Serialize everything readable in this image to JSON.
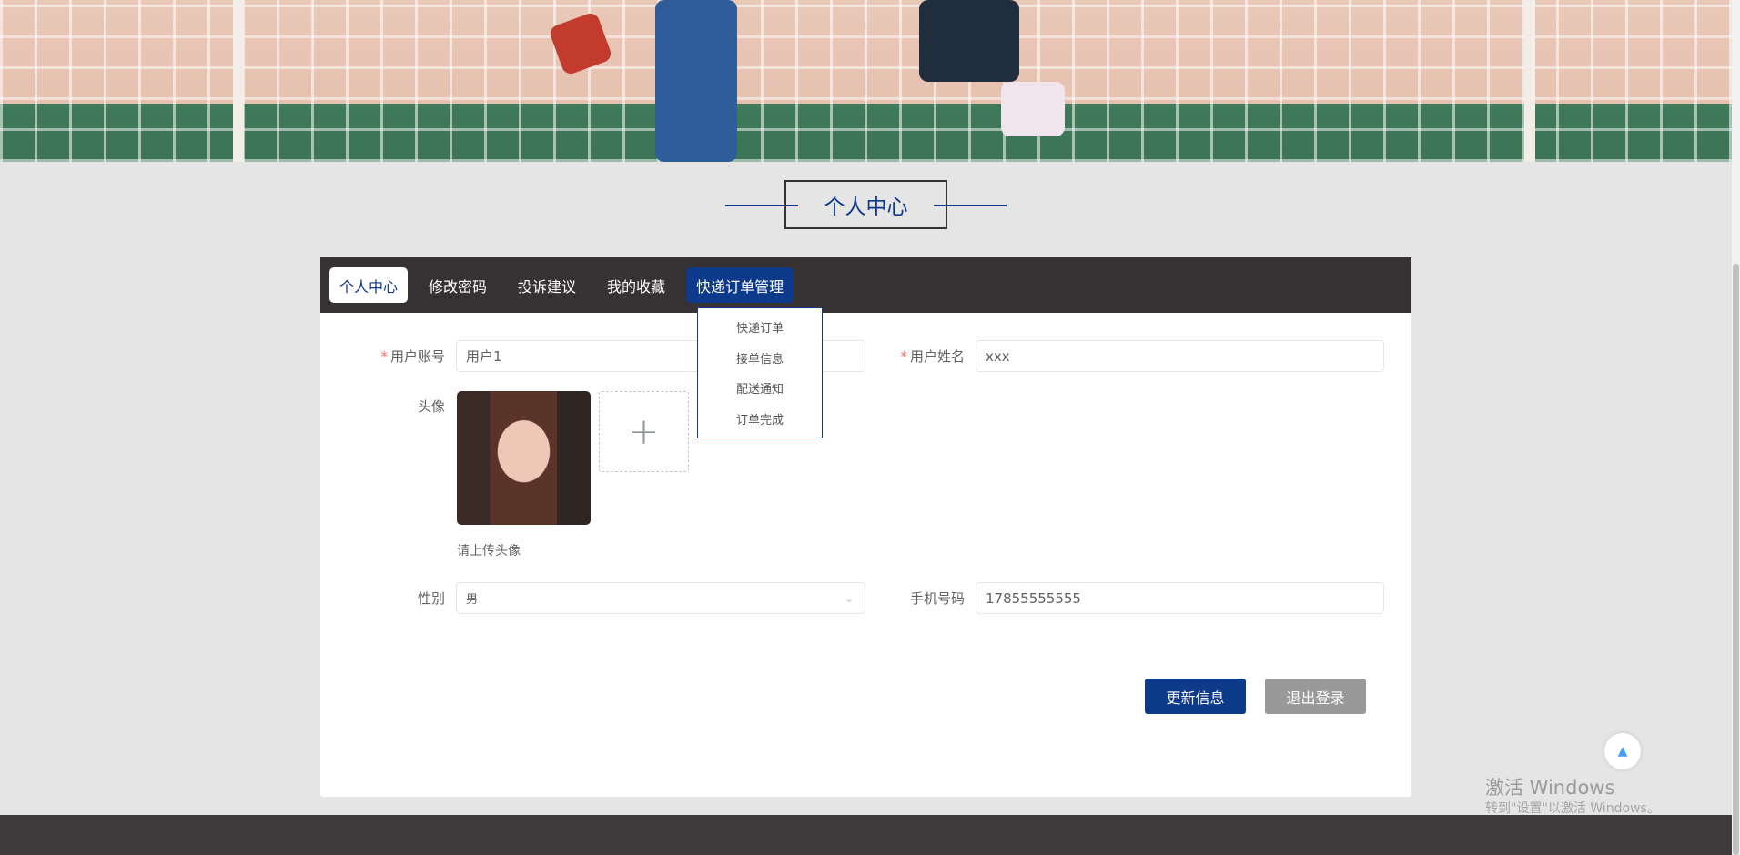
{
  "page_title": "个人中心",
  "nav": {
    "items": [
      {
        "label": "个人中心",
        "state": "active"
      },
      {
        "label": "修改密码"
      },
      {
        "label": "投诉建议"
      },
      {
        "label": "我的收藏"
      },
      {
        "label": "快递订单管理",
        "state": "hover"
      }
    ],
    "dropdown": [
      "快递订单",
      "接单信息",
      "配送通知",
      "订单完成"
    ]
  },
  "form": {
    "account_label": "用户账号",
    "account_value": "用户1",
    "name_label": "用户姓名",
    "name_value": "xxx",
    "avatar_label": "头像",
    "avatar_hint": "请上传头像",
    "upload_icon": "plus-icon",
    "gender_label": "性别",
    "gender_value": "男",
    "phone_label": "手机号码",
    "phone_value": "17855555555",
    "required_mark": "*"
  },
  "buttons": {
    "update": "更新信息",
    "logout": "退出登录"
  },
  "watermark": {
    "line1": "激活 Windows",
    "line2": "转到\"设置\"以激活 Windows。"
  },
  "colors": {
    "primary": "#0d3a8a",
    "nav_bg": "#363233",
    "logout": "#999999"
  }
}
